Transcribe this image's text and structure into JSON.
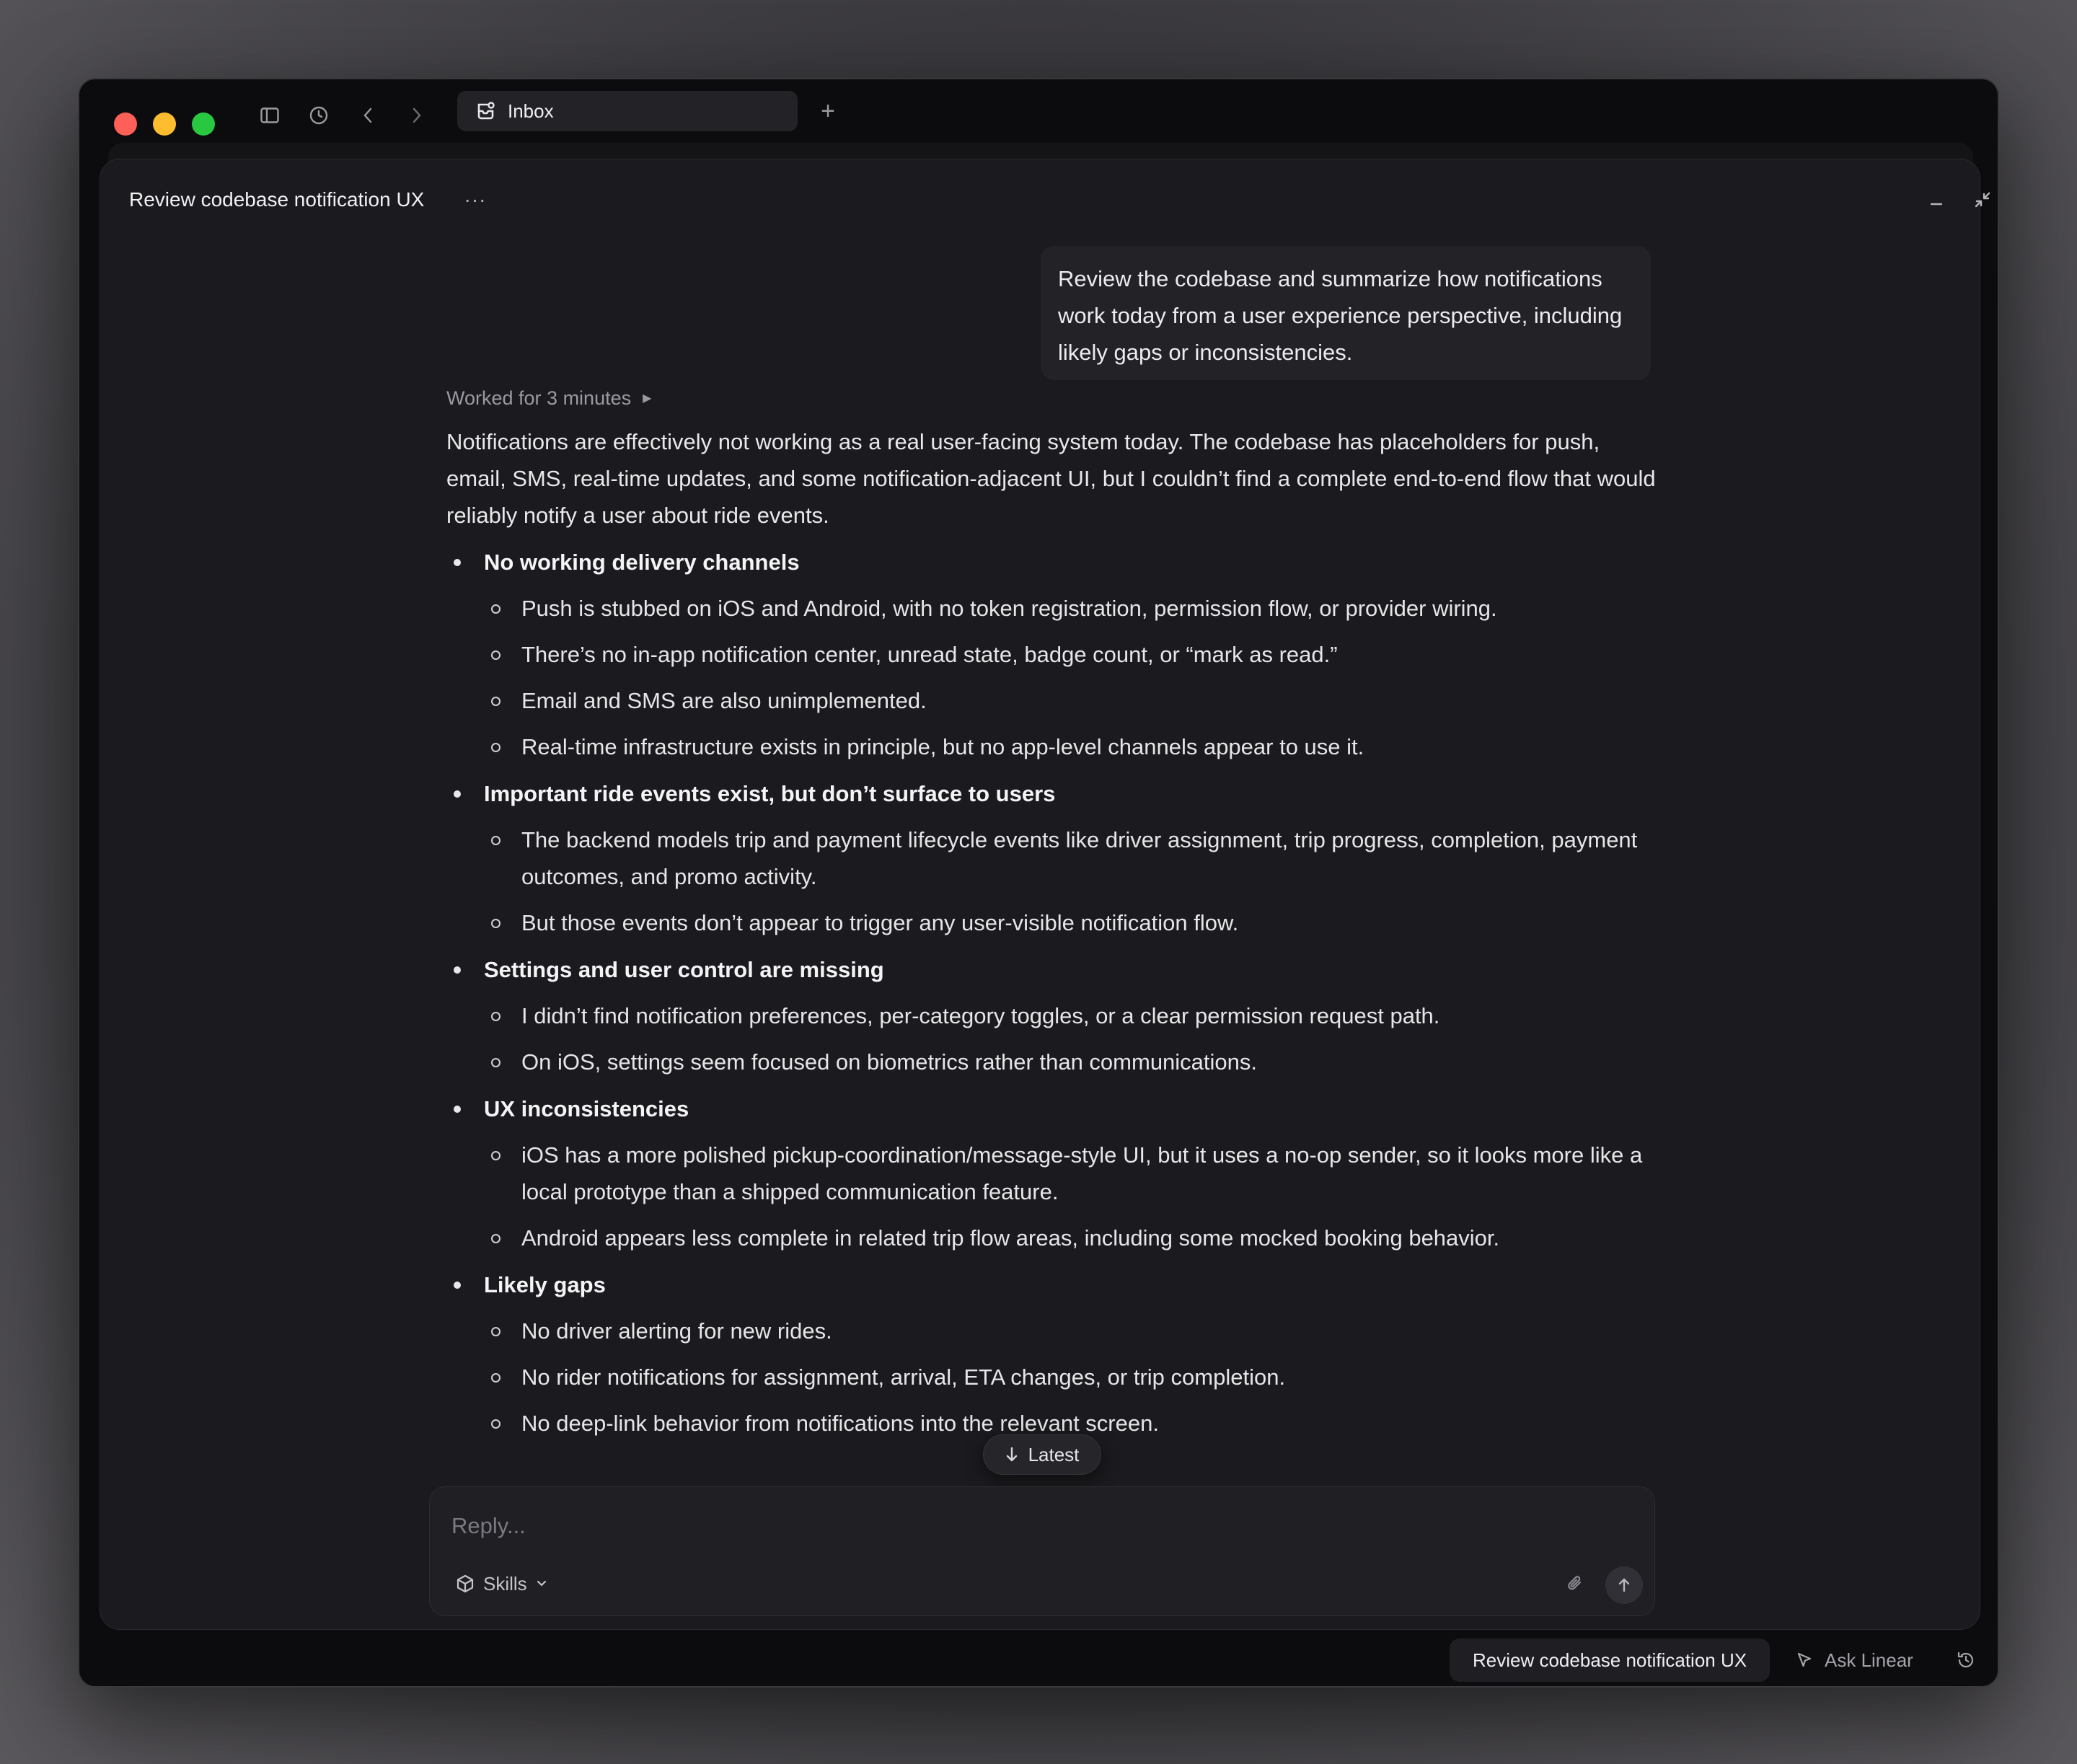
{
  "tab": {
    "label": "Inbox"
  },
  "panel": {
    "title": "Review codebase notification UX",
    "more": "···"
  },
  "user_message": "Review the codebase and summarize how notifications work today from a user experience perspective, including likely gaps or inconsistencies.",
  "assistant": {
    "worked": "Worked for 3 minutes",
    "intro": "Notifications are effectively not working as a real user-facing system today. The codebase has placeholders for push, email, SMS, real-time updates, and some notification-adjacent UI, but I couldn’t find a complete end-to-end flow that would reliably notify a user about ride events.",
    "sections": [
      {
        "heading": "No working delivery channels",
        "items": [
          "Push is stubbed on iOS and Android, with no token registration, permission flow, or provider wiring.",
          "There’s no in-app notification center, unread state, badge count, or “mark as read.”",
          "Email and SMS are also unimplemented.",
          "Real-time infrastructure exists in principle, but no app-level channels appear to use it."
        ]
      },
      {
        "heading": "Important ride events exist, but don’t surface to users",
        "items": [
          "The backend models trip and payment lifecycle events like driver assignment, trip progress, completion, payment outcomes, and promo activity.",
          "But those events don’t appear to trigger any user-visible notification flow."
        ]
      },
      {
        "heading": "Settings and user control are missing",
        "items": [
          "I didn’t find notification preferences, per-category toggles, or a clear permission request path.",
          "On iOS, settings seem focused on biometrics rather than communications."
        ]
      },
      {
        "heading": "UX inconsistencies",
        "items": [
          "iOS has a more polished pickup-coordination/message-style UI, but it uses a no-op sender, so it looks more like a local prototype than a shipped communication feature.",
          "Android appears less complete in related trip flow areas, including some mocked booking behavior."
        ]
      },
      {
        "heading": "Likely gaps",
        "items": [
          "No driver alerting for new rides.",
          "No rider notifications for assignment, arrival, ETA changes, or trip completion.",
          "No deep-link behavior from notifications into the relevant screen."
        ]
      }
    ]
  },
  "latest_button": "Latest",
  "composer": {
    "placeholder": "Reply...",
    "skills_label": "Skills"
  },
  "bottom": {
    "chip": "Review codebase notification UX",
    "ask": "Ask Linear"
  },
  "colors": {
    "traffic_red": "#fe5f57",
    "traffic_yellow": "#febc2e",
    "traffic_green": "#28c840",
    "panel_bg": "#1b1a1e"
  }
}
